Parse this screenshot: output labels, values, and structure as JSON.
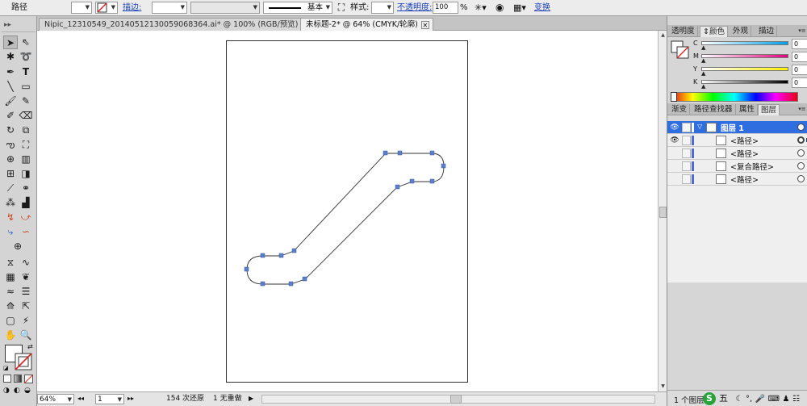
{
  "control_bar": {
    "object_type": "路径",
    "stroke_label": "描边:",
    "stroke_profile": "基本",
    "style_label": "样式:",
    "opacity_label": "不透明度:",
    "opacity_value": "100",
    "opacity_unit": "%",
    "transform_label": "变换"
  },
  "tabs": [
    {
      "title": "Nipic_12310549_20140512130059068364.ai* @ 100% (RGB/预览)",
      "active": false
    },
    {
      "title": "未标题-2* @ 64% (CMYK/轮廓)",
      "active": true
    }
  ],
  "tools": [
    "selection-tool",
    "direct-selection-tool",
    "magic-wand-tool",
    "lasso-tool",
    "pen-tool",
    "type-tool",
    "line-tool",
    "rectangle-tool",
    "paintbrush-tool",
    "pencil-tool",
    "blob-brush-tool",
    "eraser-tool",
    "rotate-tool",
    "scale-tool",
    "warp-tool",
    "free-transform-tool",
    "shape-builder-tool",
    "perspective-grid-tool",
    "mesh-tool",
    "gradient-tool",
    "eyedropper-tool",
    "blend-tool",
    "symbol-sprayer-tool",
    "column-graph-tool",
    "width-tool",
    "reshape-tool",
    "anchor-tool",
    "path-tool",
    "globe-tool",
    "envelope-tool",
    "warp-shape-tool",
    "chart-tool",
    "symbol-tool",
    "distort-tool",
    "list-tool",
    "slice-tool",
    "slice-select-tool",
    "artboard-tool",
    "knife-tool",
    "hand-tool",
    "zoom-tool"
  ],
  "status_bar": {
    "zoom": "64%",
    "artboard_number": "1",
    "undo_text": "154 次还原",
    "redo_text": "1 无重做"
  },
  "panel_color": {
    "tabs": [
      "透明度",
      "颜色",
      "外观"
    ],
    "tab_extra": "描边",
    "channels": [
      {
        "label": "C",
        "value": "0"
      },
      {
        "label": "M",
        "value": "0"
      },
      {
        "label": "Y",
        "value": "0"
      },
      {
        "label": "K",
        "value": "0"
      }
    ],
    "colors": {
      "cyan": "#00a0e9",
      "magenta": "#e4007f",
      "yellow": "#fff100",
      "black": "#000000"
    }
  },
  "panel_layers": {
    "tabs": [
      "渐变",
      "路径查找器",
      "属性",
      "图层"
    ],
    "layer_name": "图层 1",
    "items": [
      "<路径>",
      "<路径>",
      "<复合路径>",
      "<路径>"
    ],
    "layer_count": "1 个图层",
    "accent": "#2f6ee0"
  },
  "taskbar": {
    "ime_char": "五",
    "ime_logo": "S"
  }
}
